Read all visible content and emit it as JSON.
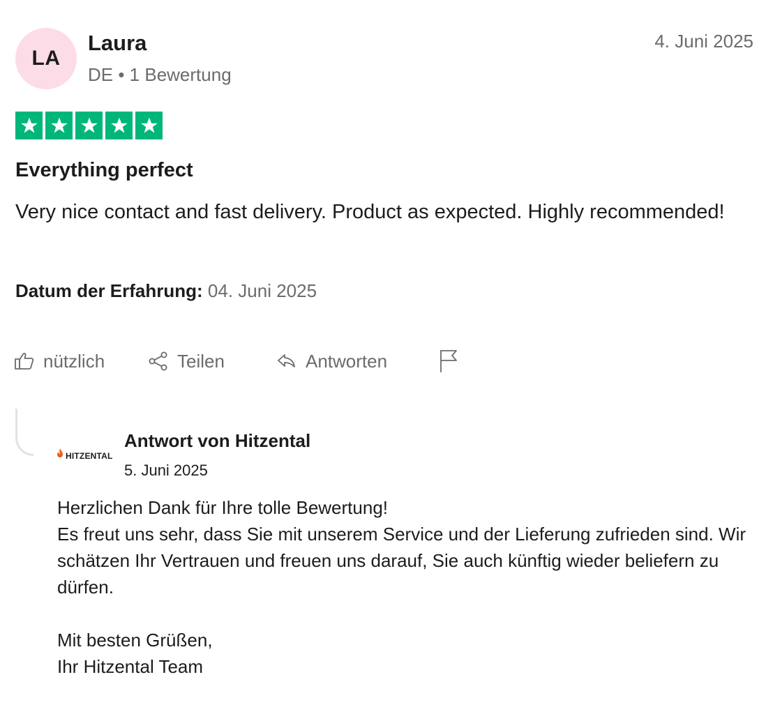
{
  "reviewer": {
    "initials": "LA",
    "name": "Laura",
    "meta": "DE • 1 Bewertung",
    "date": "4. Juni 2025"
  },
  "rating": {
    "stars": 5,
    "max": 5,
    "color": "#00b67a"
  },
  "review": {
    "title": "Everything perfect",
    "body": "Very nice contact and fast delivery. Product as expected. Highly recommended!",
    "experience_label": "Datum der Erfahrung:",
    "experience_date": "04. Juni 2025"
  },
  "actions": {
    "useful_label": "nützlich",
    "share_label": "Teilen",
    "reply_label": "Antworten",
    "icons": [
      "thumbs-up-icon",
      "share-icon",
      "reply-icon",
      "flag-icon"
    ]
  },
  "company_reply": {
    "logo_text": "HITZENTAL",
    "logo_accent": "#e8601c",
    "title": "Antwort von Hitzental",
    "date": "5. Juni 2025",
    "line1": "Herzlichen Dank für Ihre tolle Bewertung!",
    "line2": "Es freut uns sehr, dass Sie mit unserem Service und der Lieferung zufrieden sind. Wir schätzen Ihr Vertrauen und freuen uns darauf, Sie auch künftig wieder beliefern zu dürfen.",
    "line3": "Mit besten Grüßen,",
    "line4": "Ihr Hitzental Team"
  }
}
